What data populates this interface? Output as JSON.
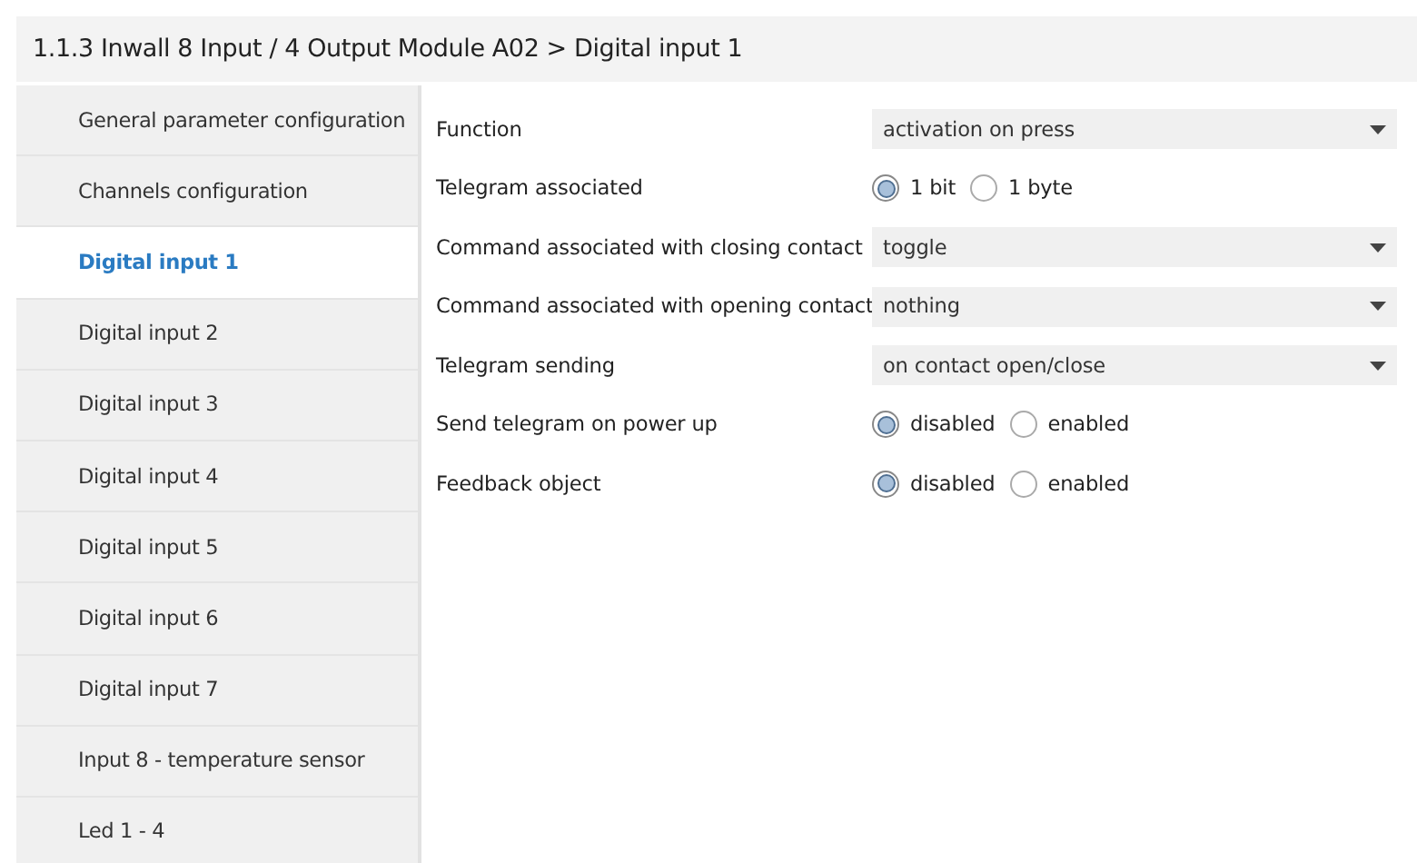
{
  "header": {
    "title": "1.1.3 Inwall 8 Input / 4 Output Module A02 > Digital input 1"
  },
  "sidebar": {
    "items": [
      {
        "label": "General parameter configuration",
        "selected": false
      },
      {
        "label": "Channels configuration",
        "selected": false
      },
      {
        "label": "Digital input 1",
        "selected": true
      },
      {
        "label": "Digital input 2",
        "selected": false
      },
      {
        "label": "Digital input 3",
        "selected": false
      },
      {
        "label": "Digital input 4",
        "selected": false
      },
      {
        "label": "Digital input 5",
        "selected": false
      },
      {
        "label": "Digital input 6",
        "selected": false
      },
      {
        "label": "Digital input 7",
        "selected": false
      },
      {
        "label": "Input 8 - temperature sensor",
        "selected": false
      },
      {
        "label": "Led 1 - 4",
        "selected": false
      }
    ]
  },
  "parameters": [
    {
      "kind": "dropdown",
      "label": "Function",
      "value": "activation on press"
    },
    {
      "kind": "radio",
      "label": "Telegram associated",
      "options": [
        {
          "label": "1 bit",
          "selected": true
        },
        {
          "label": "1 byte",
          "selected": false
        }
      ]
    },
    {
      "kind": "dropdown",
      "label": "Command associated with closing contact",
      "value": "toggle"
    },
    {
      "kind": "dropdown",
      "label": "Command associated with opening contact",
      "value": "nothing"
    },
    {
      "kind": "dropdown",
      "label": "Telegram sending",
      "value": "on contact open/close"
    },
    {
      "kind": "radio",
      "label": "Send telegram on power up",
      "options": [
        {
          "label": "disabled",
          "selected": true
        },
        {
          "label": "enabled",
          "selected": false
        }
      ]
    },
    {
      "kind": "radio",
      "label": "Feedback object",
      "options": [
        {
          "label": "disabled",
          "selected": true
        },
        {
          "label": "enabled",
          "selected": false
        }
      ]
    }
  ]
}
